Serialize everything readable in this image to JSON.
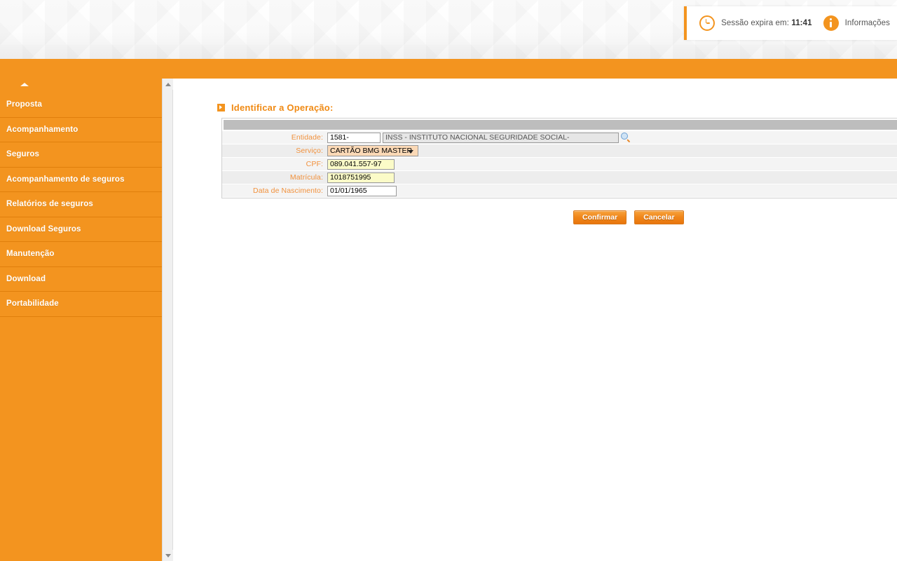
{
  "header": {
    "session_icon": "clock-icon",
    "session_label": "Sessão expira em:",
    "session_time": "11:41",
    "info_icon": "info-icon",
    "info_label": "Informações"
  },
  "sidebar": {
    "collapse_icon": "caret-up-icon",
    "items": [
      {
        "label": "Proposta"
      },
      {
        "label": "Acompanhamento"
      },
      {
        "label": "Seguros"
      },
      {
        "label": "Acompanhamento de seguros"
      },
      {
        "label": "Relatórios de seguros"
      },
      {
        "label": "Download Seguros"
      },
      {
        "label": "Manutenção"
      },
      {
        "label": "Download"
      },
      {
        "label": "Portabilidade"
      }
    ]
  },
  "scrollbar": {
    "up_icon": "scroll-up-arrow-icon",
    "down_icon": "scroll-down-arrow-icon"
  },
  "main": {
    "panel_icon": "arrow-square-icon",
    "panel_title": "Identificar a Operação:",
    "fields": {
      "entidade": {
        "label": "Entidade:",
        "code_value": "1581-",
        "desc_value": "INSS - INSTITUTO NACIONAL SEGURIDADE SOCIAL-",
        "search_icon": "magnifier-icon"
      },
      "servico": {
        "label": "Serviço:",
        "selected": "CARTÃO BMG MASTER",
        "caret_icon": "chevron-down-icon"
      },
      "cpf": {
        "label": "CPF:",
        "value": "089.041.557-97"
      },
      "matricula": {
        "label": "Matrícula:",
        "value": "1018751995"
      },
      "nascimento": {
        "label": "Data de Nascimento:",
        "value": "01/01/1965"
      }
    },
    "buttons": {
      "confirm": "Confirmar",
      "cancel": "Cancelar"
    }
  },
  "colors": {
    "brand_orange": "#f3941f",
    "label_orange": "#f1913c",
    "field_yellow": "#fbfbc8",
    "select_peach": "#fbd9b6",
    "row_gray": "#f4f4f4",
    "head_gray": "#bdbdbd"
  }
}
